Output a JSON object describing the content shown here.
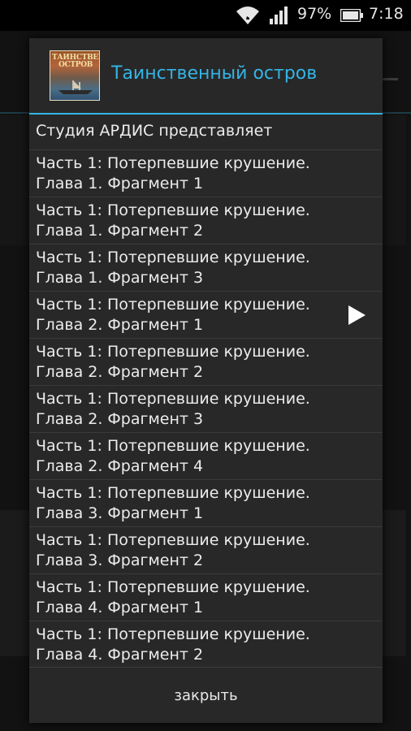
{
  "status_bar": {
    "battery_text": "97%",
    "time": "7:18",
    "icons": [
      "wifi-icon",
      "signal-icon",
      "battery-icon"
    ]
  },
  "dialog": {
    "title": "Таинственный остров",
    "cover_icon": "book-cover-icon",
    "cover_title": "ТАИНСТВЕННЫЙ ОСТРОВ",
    "accent_color": "#33b5e5",
    "items": [
      {
        "lines": [
          "Студия АРДИС представляет"
        ]
      },
      {
        "lines": [
          "Часть 1: Потерпевшие крушение.",
          "Глава 1. Фрагмент 1"
        ]
      },
      {
        "lines": [
          "Часть 1: Потерпевшие крушение.",
          "Глава 1. Фрагмент 2"
        ]
      },
      {
        "lines": [
          "Часть 1: Потерпевшие крушение.",
          "Глава 1. Фрагмент 3"
        ]
      },
      {
        "lines": [
          "Часть 1: Потерпевшие крушение.",
          "Глава 2. Фрагмент 1"
        ],
        "playing": true
      },
      {
        "lines": [
          "Часть 1: Потерпевшие крушение.",
          "Глава 2. Фрагмент 2"
        ]
      },
      {
        "lines": [
          "Часть 1: Потерпевшие крушение.",
          "Глава 2. Фрагмент 3"
        ]
      },
      {
        "lines": [
          "Часть 1: Потерпевшие крушение.",
          "Глава 2. Фрагмент 4"
        ]
      },
      {
        "lines": [
          "Часть 1: Потерпевшие крушение.",
          "Глава 3. Фрагмент 1"
        ]
      },
      {
        "lines": [
          "Часть 1: Потерпевшие крушение.",
          "Глава 3. Фрагмент 2"
        ]
      },
      {
        "lines": [
          "Часть 1: Потерпевшие крушение.",
          "Глава 4. Фрагмент 1"
        ]
      },
      {
        "lines": [
          "Часть 1: Потерпевшие крушение.",
          "Глава 4. Фрагмент 2"
        ]
      }
    ],
    "close_label": "закрыть"
  }
}
